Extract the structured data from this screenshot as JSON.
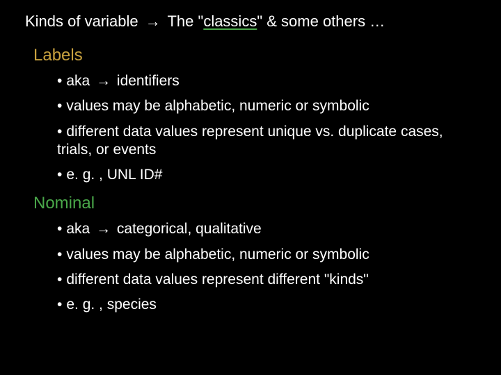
{
  "title": {
    "prefix": "Kinds of variable ",
    "arrow": "→",
    "mid1": " The \"",
    "classics": "classics",
    "mid2": "\"  & some others …"
  },
  "sections": [
    {
      "heading": "Labels",
      "color_class": "labels-color",
      "bullets": [
        {
          "prefix": "aka ",
          "arrow": "→",
          "rest": " identifiers"
        },
        {
          "prefix": "values may be alphabetic, numeric or symbolic",
          "arrow": "",
          "rest": ""
        },
        {
          "prefix": "different data values represent unique vs. duplicate cases, trials, or events",
          "arrow": "",
          "rest": ""
        },
        {
          "prefix": "e. g. , UNL ID#",
          "arrow": "",
          "rest": ""
        }
      ]
    },
    {
      "heading": "Nominal",
      "color_class": "nominal-color",
      "bullets": [
        {
          "prefix": "aka  ",
          "arrow": "→",
          "rest": "   categorical, qualitative"
        },
        {
          "prefix": "values may be alphabetic, numeric or symbolic",
          "arrow": "",
          "rest": ""
        },
        {
          "prefix": "different data values represent different \"kinds\"",
          "arrow": "",
          "rest": ""
        },
        {
          "prefix": "e. g. , species",
          "arrow": "",
          "rest": ""
        }
      ]
    }
  ]
}
